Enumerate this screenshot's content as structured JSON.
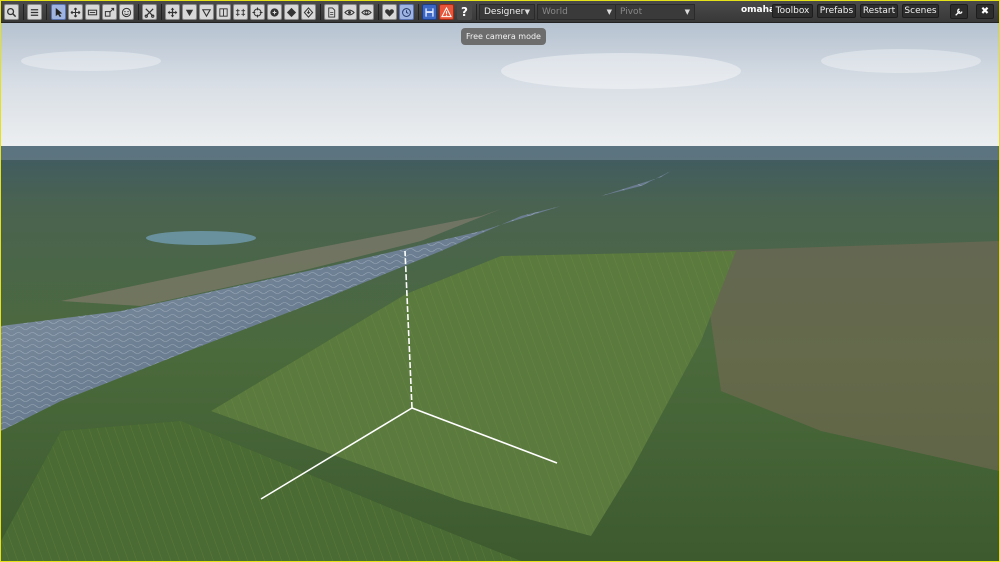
{
  "toolbar": {
    "mode_dropdown": "Designer",
    "space_dropdown": "World",
    "pivot_dropdown": "Pivot",
    "project_name": "omaha",
    "menu": {
      "toolbox": "Toolbox",
      "prefabs": "Prefabs",
      "restart": "Restart",
      "scenes": "Scenes"
    },
    "help_glyph": "?",
    "close_glyph": "✖"
  },
  "tooltip": {
    "text": "Free camera mode"
  },
  "icons": [
    "search-icon",
    "hierarchy-icon",
    "select-icon",
    "move-icon",
    "rotate-icon",
    "scale-icon",
    "smiley-icon",
    "cut-icon",
    "snap-icon",
    "terrain-down-icon",
    "terrain-flat-icon",
    "columns-icon",
    "link-icon",
    "target-icon",
    "brush-icon",
    "diamond-icon",
    "pin-icon",
    "document-icon",
    "eye-icon",
    "eye-off-icon",
    "heart-icon",
    "clock-icon",
    "save-icon",
    "warning-icon",
    "help-icon",
    "wrench-icon",
    "close-icon"
  ],
  "colors": {
    "frame_border": "#e6e21a",
    "toolbar_bg": "#3e3e3e",
    "active_tool": "#9fb4e0",
    "warning": "#e8553a"
  }
}
